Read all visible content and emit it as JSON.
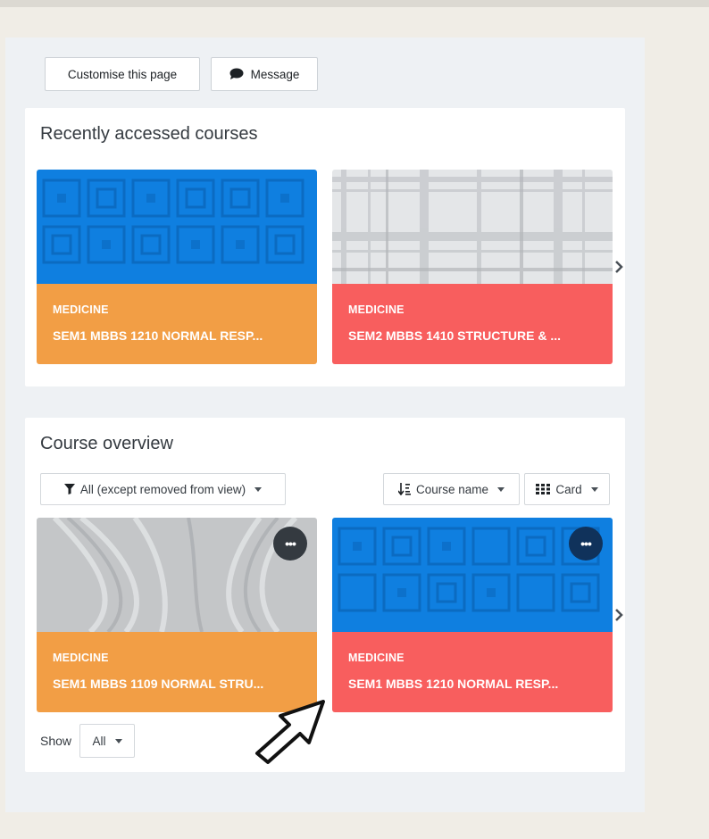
{
  "toolbar": {
    "customise_label": "Customise this page",
    "message_label": "Message"
  },
  "recent": {
    "title": "Recently accessed courses",
    "courses": [
      {
        "category": "MEDICINE",
        "name": "SEM1 MBBS 1210 NORMAL RESP...",
        "color": "#f29e45",
        "image": "blue-squares-pattern"
      },
      {
        "category": "MEDICINE",
        "name": "SEM2 MBBS 1410 STRUCTURE & ...",
        "color": "#f85e5e",
        "image": "grey-plaid-pattern"
      }
    ],
    "next_icon": "chevron-right-icon"
  },
  "overview": {
    "title": "Course overview",
    "filter_label": "All (except removed from view)",
    "sort_label": "Course name",
    "view_label": "Card",
    "courses": [
      {
        "category": "MEDICINE",
        "name": "SEM1 MBBS 1109 NORMAL STRU...",
        "color": "#f29e45",
        "image": "grey-waves-pattern"
      },
      {
        "category": "MEDICINE",
        "name": "SEM1 MBBS 1210 NORMAL RESP...",
        "color": "#f85e5e",
        "image": "blue-squares-pattern"
      }
    ],
    "menu_label": "•••",
    "show_label": "Show",
    "show_value": "All",
    "next_icon": "chevron-right-icon"
  },
  "colors": {
    "accent_blue": "#0f6cbf",
    "card_orange": "#f29e45",
    "card_red": "#f85e5e",
    "panel_bg": "#eef1f4",
    "page_bg": "#f0ede6"
  }
}
